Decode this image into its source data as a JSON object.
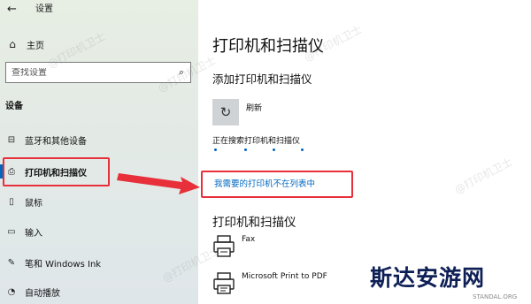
{
  "window": {
    "title": "设置"
  },
  "sidebar": {
    "home_label": "主页",
    "search_placeholder": "查找设置",
    "section_title": "设备",
    "items": [
      {
        "label": "蓝牙和其他设备",
        "icon": "bluetooth-devices-icon"
      },
      {
        "label": "打印机和扫描仪",
        "icon": "printer-icon",
        "active": true
      },
      {
        "label": "鼠标",
        "icon": "mouse-icon"
      },
      {
        "label": "输入",
        "icon": "keyboard-icon"
      },
      {
        "label": "笔和 Windows Ink",
        "icon": "pen-icon"
      },
      {
        "label": "自动播放",
        "icon": "autoplay-icon"
      }
    ]
  },
  "main": {
    "title": "打印机和扫描仪",
    "add_section_title": "添加打印机和扫描仪",
    "refresh_label": "刷新",
    "searching_text": "正在搜索打印机和扫描仪",
    "missing_link": "我需要的打印机不在列表中",
    "printers_section_title": "打印机和扫描仪",
    "printers": [
      {
        "name": "Fax",
        "icon": "fax-printer-icon"
      },
      {
        "name": "Microsoft Print to PDF",
        "icon": "pdf-printer-icon"
      }
    ]
  },
  "watermark": {
    "text": "@打印机卫士"
  },
  "brand": {
    "name": "斯达安游网",
    "url": "STANDAL.ORG"
  },
  "colors": {
    "accent": "#0067c0",
    "highlight": "#e8303a",
    "sidebar_bg": "#e5ece6",
    "brand": "#0d1f55"
  }
}
